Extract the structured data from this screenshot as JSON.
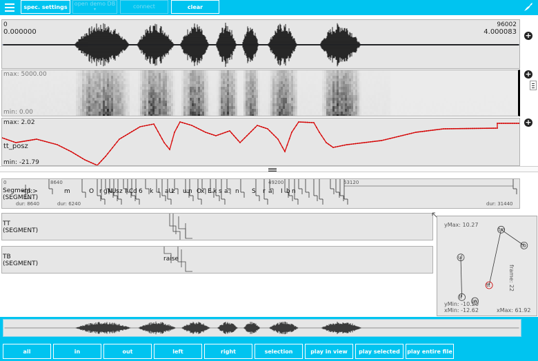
{
  "topbar": {
    "spec_settings": "spec. settings",
    "open_demo_line1": "open demo DB",
    "open_demo_line2": "▾",
    "connect": "connect",
    "clear": "clear"
  },
  "oscillogram": {
    "left_top": "0",
    "left_bottom": "0.000000",
    "right_top": "96002",
    "right_bottom": "4.000083"
  },
  "spectrogram": {
    "max_label": "max: 5000.00",
    "min_label": "min: 0.00"
  },
  "track": {
    "max_label": "max: 2.02",
    "name": "tt_posz",
    "min_label": "min: -21.79"
  },
  "segment_level": {
    "name": "Segment",
    "type": "(SEGMENT)",
    "start_tick": "0",
    "ticks": [
      "8640",
      "49200",
      "63120"
    ],
    "dur_labels": [
      "dur: 8640",
      "dur: 6240",
      "dur: 31440"
    ],
    "labels": [
      {
        "text": "<p:>"
      },
      {
        "text": "m"
      },
      {
        "text": "O"
      },
      {
        "text": "r"
      },
      {
        "text": "g"
      },
      {
        "text": "N"
      },
      {
        "text": "U"
      },
      {
        "text": "s"
      },
      {
        "text": "z"
      },
      {
        "text": "I"
      },
      {
        "text": "C"
      },
      {
        "text": "d"
      },
      {
        "text": "6"
      },
      {
        "text": "k"
      },
      {
        "text": "l"
      },
      {
        "text": "aU"
      },
      {
        "text": "z"
      },
      {
        "text": "u:"
      },
      {
        "text": "n"
      },
      {
        "text": "O"
      },
      {
        "text": "x"
      },
      {
        "text": "E"
      },
      {
        "text": "k"
      },
      {
        "text": "s"
      },
      {
        "text": "a:"
      },
      {
        "text": "n"
      },
      {
        "text": "S"
      },
      {
        "text": "r"
      },
      {
        "text": "a"
      },
      {
        "text": "I"
      },
      {
        "text": "b"
      },
      {
        "text": "n"
      }
    ]
  },
  "tt_level": {
    "name": "TT",
    "type": "(SEGMENT)"
  },
  "tb_level": {
    "name": "TB",
    "type": "(SEGMENT)",
    "item_label": "raise"
  },
  "ema": {
    "ymax": "yMax: 10.27",
    "ymin": "yMin: -10.20",
    "xmin": "xMin: -12.62",
    "xmax": "xMax: 61.92",
    "frame": "frame: 22",
    "points": [
      {
        "label": "tm",
        "x": 37,
        "y": 9
      },
      {
        "label": "tb",
        "x": 58,
        "y": 5
      },
      {
        "label": "tt",
        "x": 26,
        "y": -5
      },
      {
        "label": "ul",
        "x": 0,
        "y": 2
      },
      {
        "label": "ll",
        "x": 1,
        "y": -8
      },
      {
        "label": "jw",
        "x": 13,
        "y": -9
      }
    ]
  },
  "bottom_buttons": [
    "all",
    "in",
    "out",
    "left",
    "right",
    "selection",
    "play in view",
    "play selected",
    "play entire file"
  ]
}
